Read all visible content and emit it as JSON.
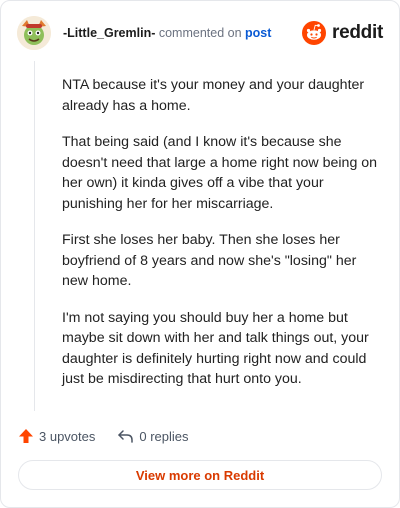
{
  "comment": {
    "username": "-Little_Gremlin-",
    "commented_text": "commented on",
    "post_link": "post",
    "paragraphs": [
      "NTA because it's your money and your daughter already has a home.",
      "That being said (and I know it's because she doesn't need that large a home right now being on her own) it kinda gives off a vibe that your punishing her for her miscarriage.",
      "First she loses her baby. Then she loses her boyfriend of 8 years and now she's \"losing\" her new home.",
      "I'm not saying you should buy her a home but maybe sit down with her and talk things out, your daughter is definitely hurting right now and could just be misdirecting that hurt onto you."
    ]
  },
  "brand": {
    "wordmark": "reddit",
    "icon": "reddit-snoo-icon",
    "color": "#ff4500"
  },
  "actions": {
    "upvotes": "3 upvotes",
    "upvote_icon": "upvote-arrow-icon",
    "upvote_color": "#ff4500",
    "replies": "0 replies",
    "reply_icon": "reply-arrow-icon"
  },
  "footer": {
    "view_more": "View more on Reddit"
  },
  "colors": {
    "link": "#0a5ad4",
    "view_more": "#d93a00"
  }
}
